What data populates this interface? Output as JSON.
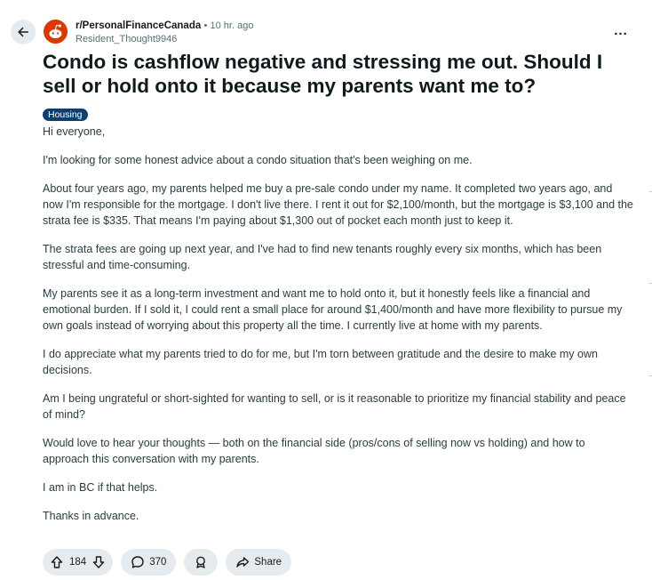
{
  "post": {
    "subreddit": "r/PersonalFinanceCanada",
    "separator": "•",
    "time": "10 hr. ago",
    "author": "Resident_Thought9946",
    "overflow": "...",
    "title": "Condo is cashflow negative and stressing me out. Should I sell or hold onto it because my parents want me to?",
    "flair": "Housing",
    "paragraphs": [
      "Hi everyone,",
      "I'm looking for some honest advice about a condo situation that's been weighing on me.",
      "About four years ago, my parents helped me buy a pre-sale condo under my name. It completed two years ago, and now I'm responsible for the mortgage. I don't live there. I rent it out for $2,100/month, but the mortgage is $3,100 and the strata fee is $335. That means I'm paying about $1,300 out of pocket each month just to keep it.",
      "The strata fees are going up next year, and I've had to find new tenants roughly every six months, which has been stressful and time-consuming.",
      "My parents see it as a long-term investment and want me to hold onto it, but it honestly feels like a financial and emotional burden. If I sold it, I could rent a small place for around $1,400/month and have more flexibility to pursue my own goals instead of worrying about this property all the time. I currently live at home with my parents.",
      "I do appreciate what my parents tried to do for me, but I'm torn between gratitude and the desire to make my own decisions.",
      "Am I being ungrateful or short-sighted for wanting to sell, or is it reasonable to prioritize my financial stability and peace of mind?",
      "Would love to hear your thoughts — both on the financial side (pros/cons of selling now vs holding) and how to approach this conversation with my parents.",
      "I am in BC if that helps.",
      "Thanks in advance."
    ]
  },
  "actions": {
    "votes": "184",
    "comments": "370",
    "share": "Share"
  },
  "icons": {
    "back": "arrow-left-icon",
    "avatar": "subreddit-avatar-icon",
    "upvote": "arrow-up-icon",
    "downvote": "arrow-down-icon",
    "comment": "speech-bubble-icon",
    "award": "award-icon",
    "share": "share-arrow-icon"
  },
  "colors": {
    "flair_bg": "#0e3f6e",
    "avatar_bg": "#d93a00",
    "pill_bg": "#e5ebee"
  }
}
